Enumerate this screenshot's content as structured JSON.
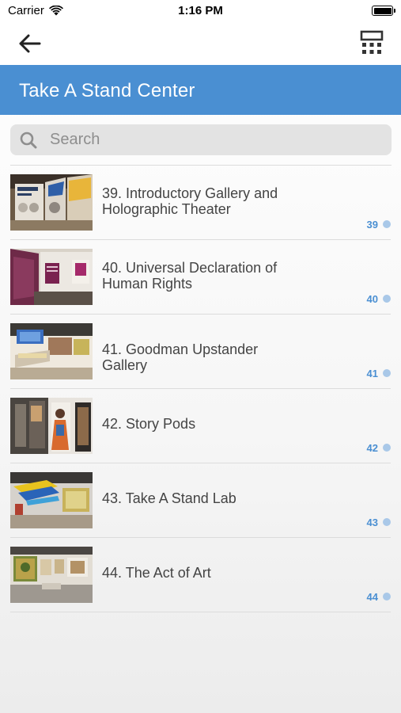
{
  "status_bar": {
    "carrier": "Carrier",
    "time": "1:16 PM"
  },
  "nav": {
    "back_icon": "arrow-left-icon",
    "right_icon": "calculator-icon"
  },
  "header": {
    "title": "Take A Stand Center",
    "color": "#4a8fd2"
  },
  "search": {
    "placeholder": "Search",
    "value": ""
  },
  "items": [
    {
      "title": "39. Introductory Gallery and Holographic Theater",
      "number": "39"
    },
    {
      "title": "40. Universal Declaration of Human Rights",
      "number": "40"
    },
    {
      "title": "41. Goodman Upstander Gallery",
      "number": "41"
    },
    {
      "title": "42. Story Pods",
      "number": "42"
    },
    {
      "title": "43. Take A Stand Lab",
      "number": "43"
    },
    {
      "title": "44. The Act of Art",
      "number": "44"
    }
  ]
}
